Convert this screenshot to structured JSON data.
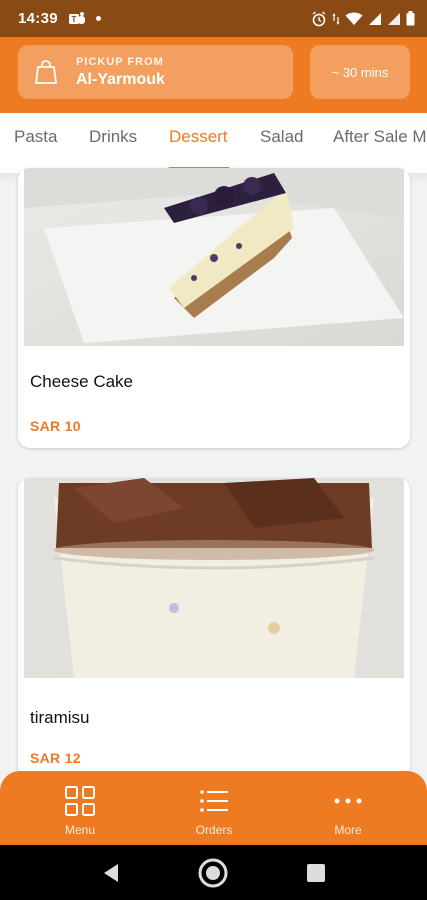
{
  "status_bar": {
    "time": "14:39"
  },
  "header": {
    "pickup_label": "PICKUP FROM",
    "pickup_location": "Al-Yarmouk",
    "eta": "~ 30 mins",
    "accent_color": "#ee7a22"
  },
  "tabs": [
    {
      "label": "Pasta",
      "active": false
    },
    {
      "label": "Drinks",
      "active": false
    },
    {
      "label": "Dessert",
      "active": true
    },
    {
      "label": "Salad",
      "active": false
    },
    {
      "label": "After Sale M",
      "active": false
    }
  ],
  "products": [
    {
      "name": "Cheese Cake",
      "price": "SAR 10"
    },
    {
      "name": "tiramisu",
      "price": "SAR 12"
    }
  ],
  "bottom_nav": [
    {
      "label": "Menu",
      "icon": "grid-icon"
    },
    {
      "label": "Orders",
      "icon": "list-icon"
    },
    {
      "label": "More",
      "icon": "more-dots-icon"
    }
  ]
}
